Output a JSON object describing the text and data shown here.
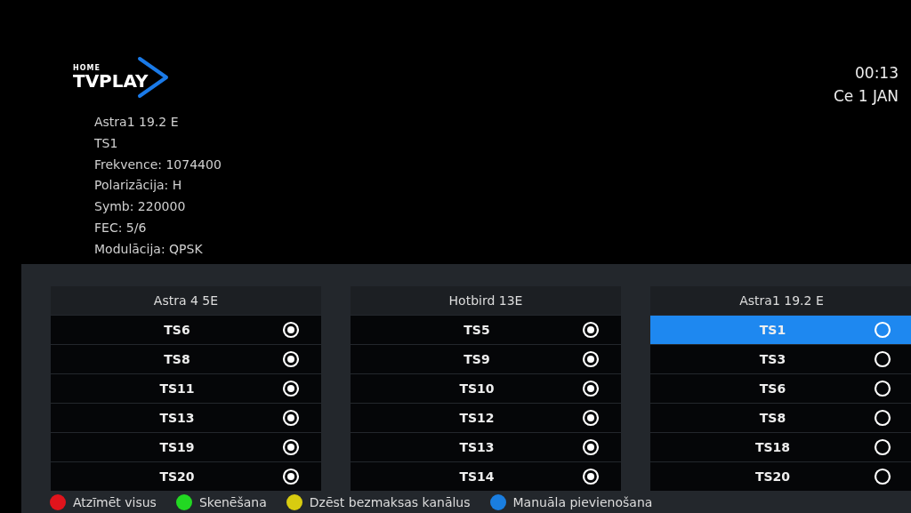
{
  "logo": {
    "small": "HOME",
    "main": "TVPLAY"
  },
  "clock": {
    "time": "00:13",
    "date": "Ce 1 JAN"
  },
  "info": [
    "Astra1 19.2 E",
    "TS1",
    "Frekvence: 1074400",
    "Polarizācija: H",
    "Symb: 220000",
    "FEC: 5/6",
    "Modulācija: QPSK"
  ],
  "satellites": [
    {
      "name": "Astra 4 5E",
      "transponders": [
        {
          "label": "TS6",
          "checked": true,
          "selected": false
        },
        {
          "label": "TS8",
          "checked": true,
          "selected": false
        },
        {
          "label": "TS11",
          "checked": true,
          "selected": false
        },
        {
          "label": "TS13",
          "checked": true,
          "selected": false
        },
        {
          "label": "TS19",
          "checked": true,
          "selected": false
        },
        {
          "label": "TS20",
          "checked": true,
          "selected": false
        }
      ]
    },
    {
      "name": "Hotbird 13E",
      "transponders": [
        {
          "label": "TS5",
          "checked": true,
          "selected": false
        },
        {
          "label": "TS9",
          "checked": true,
          "selected": false
        },
        {
          "label": "TS10",
          "checked": true,
          "selected": false
        },
        {
          "label": "TS12",
          "checked": true,
          "selected": false
        },
        {
          "label": "TS13",
          "checked": true,
          "selected": false
        },
        {
          "label": "TS14",
          "checked": true,
          "selected": false
        }
      ]
    },
    {
      "name": "Astra1 19.2 E",
      "transponders": [
        {
          "label": "TS1",
          "checked": false,
          "selected": true
        },
        {
          "label": "TS3",
          "checked": false,
          "selected": false
        },
        {
          "label": "TS6",
          "checked": false,
          "selected": false
        },
        {
          "label": "TS8",
          "checked": false,
          "selected": false
        },
        {
          "label": "TS18",
          "checked": false,
          "selected": false
        },
        {
          "label": "TS20",
          "checked": false,
          "selected": false
        }
      ]
    }
  ],
  "legend": [
    {
      "label": "Atzīmēt visus",
      "color": "#e0141c"
    },
    {
      "label": "Skenēšana",
      "color": "#22d822"
    },
    {
      "label": "Dzēst bezmaksas kanālus",
      "color": "#d8cc10"
    },
    {
      "label": "Manuāla pievienošana",
      "color": "#1a7ee0"
    }
  ]
}
